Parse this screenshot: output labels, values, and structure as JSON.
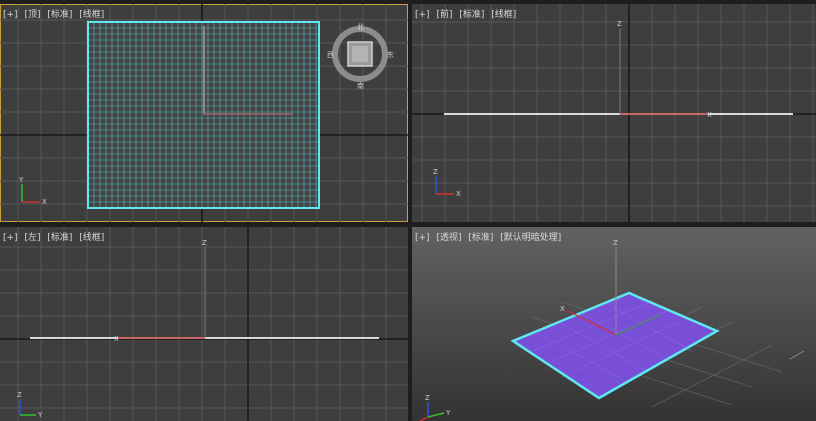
{
  "viewports": {
    "top": {
      "labels": [
        "[+]",
        "[顶]",
        "[标准]",
        "[线框]"
      ]
    },
    "front": {
      "labels": [
        "[+]",
        "[前]",
        "[标准]",
        "[线框]"
      ]
    },
    "left": {
      "labels": [
        "[+]",
        "[左]",
        "[标准]",
        "[线框]"
      ]
    },
    "perspective": {
      "labels": [
        "[+]",
        "[透视]",
        "[标准]",
        "[默认明暗处理]"
      ]
    }
  },
  "viewcube": {
    "north": "北",
    "south": "南",
    "west": "西",
    "east": "东"
  },
  "axes": {
    "x": "X",
    "y": "Y",
    "z": "Z"
  },
  "colors": {
    "viewport_bg": "#3e3e3e",
    "grid_line": "#5a5a5a",
    "grid_main": "#121212",
    "active_border": "#c9a13a",
    "selection": "#5ee8f0",
    "plane_fill": "#7a4fd8",
    "x_axis": "#d03030",
    "y_axis": "#30c030",
    "z_axis": "#3050e0"
  }
}
